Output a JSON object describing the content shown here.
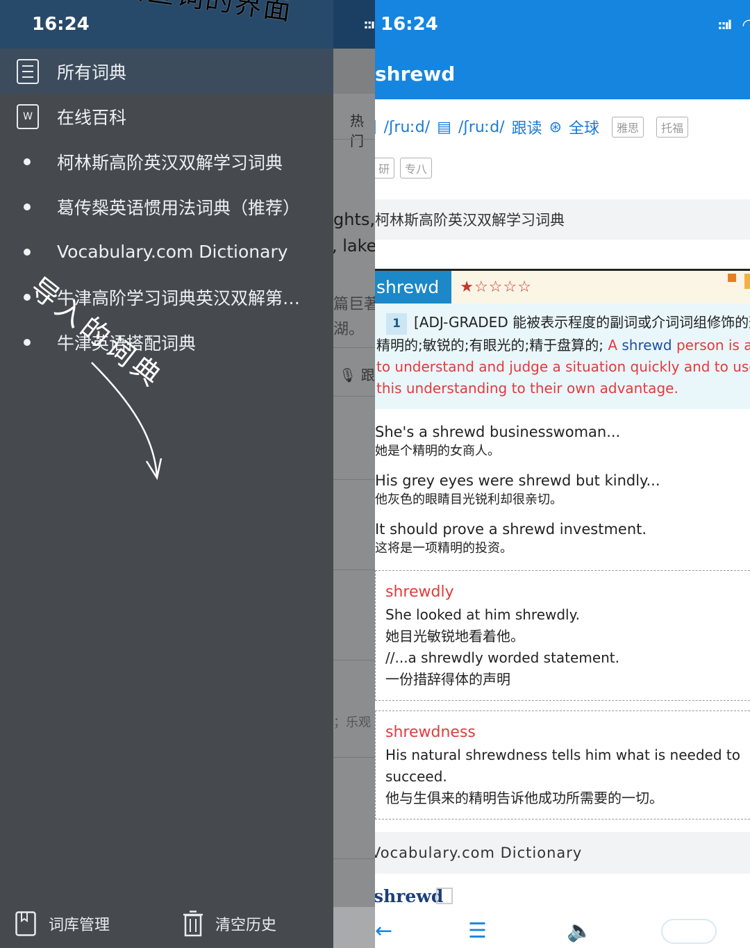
{
  "left": {
    "status_time": "16:24",
    "menu": [
      {
        "label": "所有词典",
        "icon": "document-list-icon"
      },
      {
        "label": "在线百科",
        "icon": "word-doc-icon",
        "icon_text": "W"
      }
    ],
    "dictionaries": [
      "柯林斯高阶英汉双解学习词典",
      "葛传椝英语惯用法词典（推荐）",
      "Vocabulary.com Dictionary",
      "牛津高阶学习词典英汉双解第…",
      "牛津英语搭配词典"
    ],
    "bottom": {
      "manage_label": "词库管理",
      "clear_label": "清空历史"
    }
  },
  "mid": {
    "hot_label": "热门",
    "text_lines": [
      "ghts,",
      ", lake"
    ],
    "cn_lines": [
      "篇巨著",
      "湖。"
    ],
    "mic_label": "跟",
    "side_note": "；乐观"
  },
  "right": {
    "status_time": "16:24",
    "header_word": "shrewd",
    "phonetic_uk": "/ʃruːd/",
    "phonetic_us": "/ʃruːd/",
    "follow_read": "跟读",
    "global_label": "全球",
    "tags_row1": [
      "雅思",
      "托福"
    ],
    "tags_row2": [
      "研",
      "专八"
    ],
    "dict_header": "柯林斯高阶英汉双解学习词典",
    "entry_word": "shrewd",
    "stars": "★☆☆☆☆",
    "definition": {
      "num": "1",
      "grammar": "[ADJ-GRADED 能被表示程度的副词或介词词组修饰的形容词]",
      "cn": "精明的;敏锐的;有眼光的;精于盘算的;",
      "en_line1_a": "A ",
      "en_line1_b": "shrewd",
      "en_line1_c": " person is able",
      "en_line2": "to understand and judge a situation quickly and to use",
      "en_line3": "this understanding to their own advantage."
    },
    "examples": [
      {
        "en": "She's a shrewd businesswoman...",
        "zh": "她是个精明的女商人。"
      },
      {
        "en": "His grey eyes were shrewd but kindly...",
        "zh": "他灰色的眼睛目光锐利却很亲切。"
      },
      {
        "en": "It should prove a shrewd investment.",
        "zh": "这将是一项精明的投资。"
      }
    ],
    "derivatives": [
      {
        "word": "shrewdly",
        "lines": [
          "She looked at him shrewdly.",
          "她目光敏锐地看着他。",
          "//...a shrewdly worded statement.",
          "一份措辞得体的声明"
        ]
      },
      {
        "word": "shrewdness",
        "lines": [
          "His natural shrewdness tells him what is needed to",
          "succeed.",
          "他与生俱来的精明告诉他成功所需要的一切。"
        ]
      }
    ],
    "voc_header": "Vocabulary.com Dictionary",
    "voc_word": "shrewd"
  },
  "annotations": {
    "top_note": "导入词典后查词的界面",
    "left_note": "导入的词典"
  },
  "colors": {
    "left_bg": "#464a4f",
    "status_dark": "#284a6a",
    "accent_blue": "#1585e0",
    "entry_blue": "#1c88c8",
    "red": "#e23b3b"
  }
}
